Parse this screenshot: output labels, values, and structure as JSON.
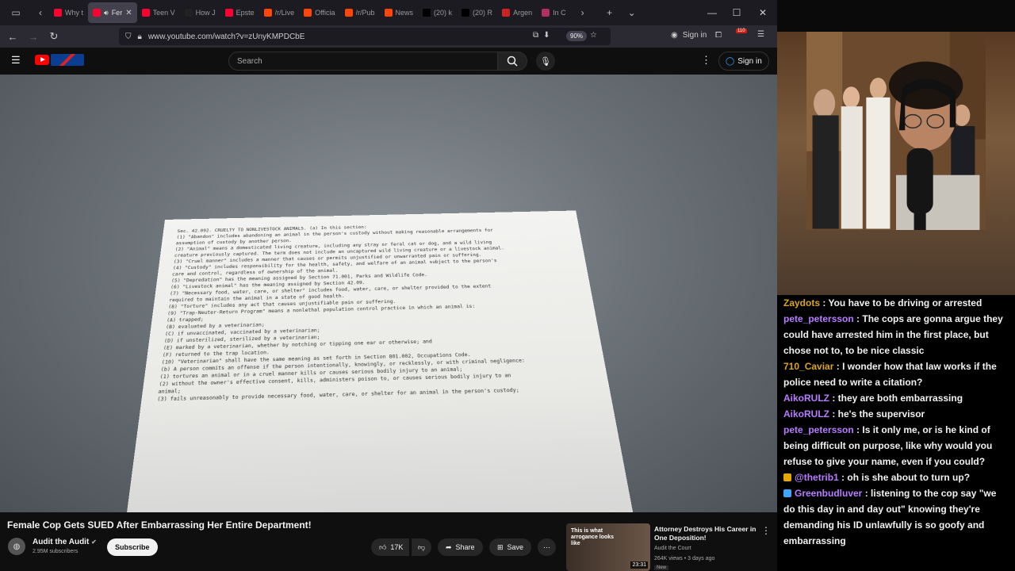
{
  "browser": {
    "tabs": [
      {
        "label": "Why t",
        "color": "#ff0033",
        "active": false
      },
      {
        "label": "Fer",
        "color": "#ff0033",
        "active": true
      },
      {
        "label": "Teen V",
        "color": "#ff0033",
        "active": false
      },
      {
        "label": "How J",
        "color": "#222222",
        "active": false
      },
      {
        "label": "Epste",
        "color": "#ff0033",
        "active": false
      },
      {
        "label": "/r/Live",
        "color": "#ff4500",
        "active": false
      },
      {
        "label": "Officia",
        "color": "#ff4500",
        "active": false
      },
      {
        "label": "/r/Pub",
        "color": "#ff4500",
        "active": false
      },
      {
        "label": "News",
        "color": "#ff4500",
        "active": false
      },
      {
        "label": "(20) k",
        "color": "#000000",
        "active": false
      },
      {
        "label": "(20) R",
        "color": "#000000",
        "active": false
      },
      {
        "label": "Argen",
        "color": "#cc2222",
        "active": false
      },
      {
        "label": "In C",
        "color": "#b03060",
        "active": false
      }
    ],
    "url": "www.youtube.com/watch?v=zUnyKMPDCbE",
    "zoom": "90%",
    "sign_in": "Sign in",
    "notification_count": "110"
  },
  "youtube": {
    "search_placeholder": "Search",
    "sign_in": "Sign in",
    "video": {
      "title": "Female Cop Gets SUED After Embarrassing Her Entire Department!",
      "channel": "Audit the Audit",
      "subscribers": "2.95M subscribers",
      "subscribe_label": "Subscribe",
      "likes": "17K",
      "share_label": "Share",
      "save_label": "Save"
    },
    "document_lines": [
      "Sec. 42.092.  CRUELTY TO NONLIVESTOCK ANIMALS.  (a)  In this section:",
      "  (1)  \"Abandon\" includes abandoning an animal in the person's custody without making reasonable arrangements for",
      "assumption of custody by another person.",
      "  (2)  \"Animal\" means a domesticated living creature, including any stray or feral cat or dog, and a wild living",
      "creature previously captured.  The term does not include an uncaptured wild living creature or a livestock animal.",
      "  (3)  \"Cruel manner\" includes a manner that causes or permits unjustified or unwarranted pain or suffering.",
      "  (4)  \"Custody\" includes responsibility for the health, safety, and welfare of an animal subject to the person's",
      "care and control, regardless of ownership of the animal.",
      "  (5)  \"Depredation\" has the meaning assigned by Section 71.001, Parks and Wildlife Code.",
      "  (6)  \"Livestock animal\" has the meaning assigned by Section 42.09.",
      "  (7)  \"Necessary food, water, care, or shelter\" includes food, water, care, or shelter provided to the extent",
      "required to maintain the animal in a state of good health.",
      "  (8)  \"Torture\" includes any act that causes unjustifiable pain or suffering.",
      "  (9)  \"Trap-Neuter-Return Program\" means a nonlethal population control practice in which an animal is:",
      "    (A)  trapped;",
      "    (B)  evaluated by a veterinarian;",
      "    (C)  if unvaccinated, vaccinated by a veterinarian;",
      "    (D)  if unsterilized, sterilized by a veterinarian;",
      "    (E)  marked by a veterinarian, whether by notching or tipping one ear or otherwise; and",
      "    (F)  returned to the trap location.",
      "  (10)  \"Veterinarian\" shall have the same meaning as set forth in Section 801.002, Occupations Code.",
      "  (b)  A person commits an offense if the person intentionally, knowingly, or recklessly, or with criminal negligence:",
      "    (1)  tortures an animal or in a cruel manner kills or causes serious bodily injury to an animal;",
      "    (2)  without the owner's effective consent, kills, administers poison to, or causes serious bodily injury to an",
      "animal;",
      "    (3)  fails unreasonably to provide necessary food, water, care, or shelter for an animal in the person's custody;"
    ],
    "recommendation": {
      "thumb_text": "This is what arrogance looks like",
      "duration": "23:31",
      "title": "Attorney Destroys His Career in One Deposition!",
      "channel": "Audit the Court",
      "meta": "264K views • 3 days ago",
      "badge": "New"
    }
  },
  "chat": [
    {
      "user": "Zaydots",
      "color": "#daa520",
      "text": "You have to be driving or arrested",
      "badge": ""
    },
    {
      "user": "pete_petersson",
      "color": "#b77cff",
      "text": "The cops are gonna argue they could have arrested him in the first place, but chose not to, to be nice classic",
      "badge": ""
    },
    {
      "user": "710_Caviar",
      "color": "#daa520",
      "text": "I wonder how that law works if the police need to write a citation?",
      "badge": ""
    },
    {
      "user": "AikoRULZ",
      "color": "#b77cff",
      "text": "they are both embarrassing",
      "badge": ""
    },
    {
      "user": "AikoRULZ",
      "color": "#b77cff",
      "text": "he's the supervisor",
      "badge": ""
    },
    {
      "user": "pete_petersson",
      "color": "#b77cff",
      "text": "Is it only me, or is he kind of being difficult on purpose, like why would you refuse to give your name, even if you could?",
      "badge": ""
    },
    {
      "user": "@thetrib1",
      "color": "#b77cff",
      "text": "oh is she about to turn up?",
      "badge": "#e6a800"
    },
    {
      "user": "Greenbudluver",
      "color": "#b77cff",
      "text": "listening to the cop say \"we do this day in and day out\" knowing they're demanding his ID unlawfully is so goofy and embarrassing",
      "badge": "#3ea6ff"
    }
  ]
}
